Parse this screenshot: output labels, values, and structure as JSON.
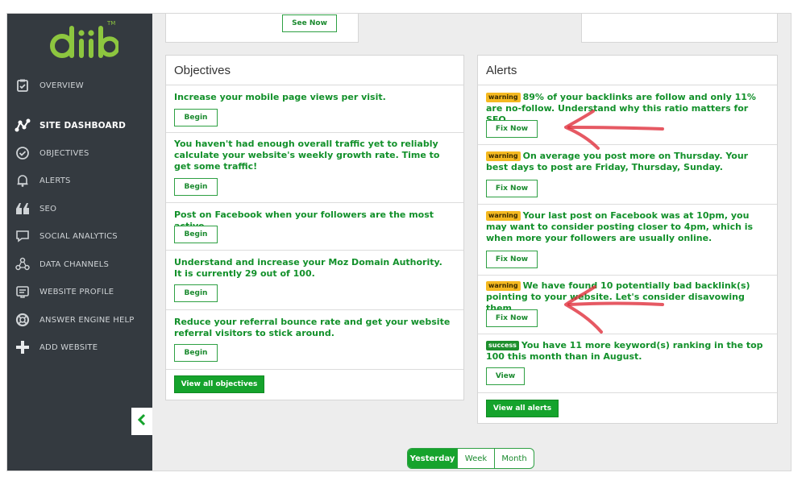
{
  "brand": {
    "logo_text": "diib",
    "tm": "TM",
    "color": "#8dc63f"
  },
  "sidebar": {
    "items": [
      {
        "label": "OVERVIEW",
        "icon": "clipboard-check-icon",
        "active": false
      },
      {
        "label": "SITE DASHBOARD",
        "icon": "network-nodes-icon",
        "active": true
      },
      {
        "label": "OBJECTIVES",
        "icon": "check-circle-icon",
        "active": false
      },
      {
        "label": "ALERTS",
        "icon": "bell-icon",
        "active": false
      },
      {
        "label": "SEO",
        "icon": "quote-icon",
        "active": false
      },
      {
        "label": "SOCIAL ANALYTICS",
        "icon": "chat-bubble-icon",
        "active": false
      },
      {
        "label": "DATA CHANNELS",
        "icon": "share-nodes-icon",
        "active": false
      },
      {
        "label": "WEBSITE PROFILE",
        "icon": "id-card-icon",
        "active": false
      },
      {
        "label": "ANSWER ENGINE HELP",
        "icon": "lifebuoy-icon",
        "active": false
      },
      {
        "label": "ADD WEBSITE",
        "icon": "plus-icon",
        "active": false
      }
    ],
    "collapse_icon": "chevron-left-icon"
  },
  "top": {
    "see_now_label": "See Now"
  },
  "objectives": {
    "title": "Objectives",
    "items": [
      {
        "text": "Increase your mobile page views per visit.",
        "button": "Begin"
      },
      {
        "text": "You haven't had enough overall traffic yet to reliably calculate your website's weekly growth rate. Time to get some traffic!",
        "button": "Begin"
      },
      {
        "text": "Post on Facebook when your followers are the most active.",
        "button": "Begin"
      },
      {
        "text": "Understand and increase your Moz Domain Authority. It is currently 29 out of 100.",
        "button": "Begin"
      },
      {
        "text": "Reduce your referral bounce rate and get your website referral visitors to stick around.",
        "button": "Begin"
      }
    ],
    "view_all_label": "View all objectives"
  },
  "alerts": {
    "title": "Alerts",
    "items": [
      {
        "badge": "warning",
        "text": "89% of your backlinks are follow and only 11% are no-follow. Understand why this ratio matters for SEO.",
        "button": "Fix Now"
      },
      {
        "badge": "warning",
        "text": "On average you post more on Thursday. Your best days to post are Friday, Thursday, Sunday.",
        "button": "Fix Now"
      },
      {
        "badge": "warning",
        "text": "Your last post on Facebook was at 10pm, you may want to consider posting closer to 4pm, which is when more your followers are usually online.",
        "button": "Fix Now"
      },
      {
        "badge": "warning",
        "text": "We have found 10 potentially bad backlink(s) pointing to your website. Let's consider disavowing them.",
        "button": "Fix Now"
      },
      {
        "badge": "success",
        "text": "You have 11 more keyword(s) ranking in the top 100 this month than in August.",
        "button": "View"
      }
    ],
    "view_all_label": "View all alerts"
  },
  "period": {
    "options": [
      "Yesterday",
      "Week",
      "Month"
    ],
    "selected": "Yesterday"
  },
  "colors": {
    "sidebar_bg": "#343a40",
    "accent_green": "#15a32c",
    "text_green": "#12902a",
    "warning_badge": "#f5b921",
    "annotation_red": "#e0303c"
  }
}
